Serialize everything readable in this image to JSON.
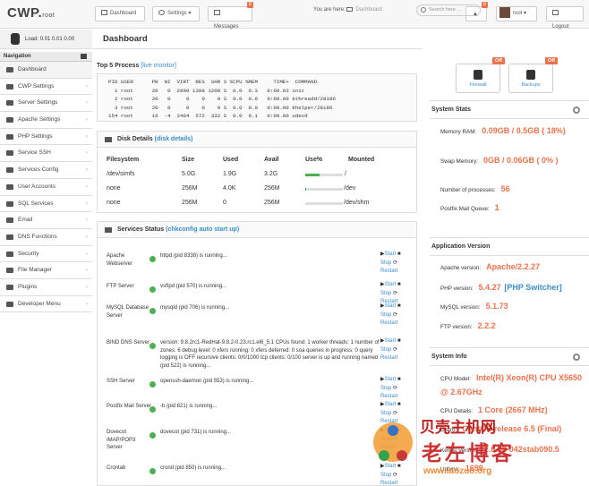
{
  "app": {
    "logo": "CWP.",
    "logo_sub": "root"
  },
  "topbar": {
    "dashboard": "Dashboard",
    "settings": "Settings",
    "messages": "Messages",
    "messages_badge": "8",
    "alerts_badge": "8",
    "user": "root",
    "logout": "Logout"
  },
  "load": {
    "label": "Load:",
    "values": "0.01  0.01  0.00"
  },
  "nav": {
    "header": "Navigation",
    "items": [
      {
        "label": "Dashboard",
        "caret": ""
      },
      {
        "label": "CWP Settings",
        "caret": "›"
      },
      {
        "label": "Server Settings",
        "caret": "›"
      },
      {
        "label": "Apache Settings",
        "caret": "›"
      },
      {
        "label": "PHP Settings",
        "caret": "›"
      },
      {
        "label": "Service SSH",
        "caret": "›"
      },
      {
        "label": "Services Config",
        "caret": "›"
      },
      {
        "label": "User Accounts",
        "caret": "›"
      },
      {
        "label": "SQL Services",
        "caret": "›"
      },
      {
        "label": "Email",
        "caret": "›"
      },
      {
        "label": "DNS Functions",
        "caret": "›"
      },
      {
        "label": "Security",
        "caret": "›"
      },
      {
        "label": "File Manager",
        "caret": "›"
      },
      {
        "label": "Plugins",
        "caret": "›"
      },
      {
        "label": "Developer Menu",
        "caret": "›"
      }
    ]
  },
  "page": {
    "title": "Dashboard",
    "breadcrumb_prefix": "You are here:",
    "breadcrumb": "Dashboard",
    "search_placeholder": "Search here ..."
  },
  "top5": {
    "title": "Top 5 Process",
    "link": "[live monitor]",
    "text": "PID USER      PR  NI  VIRT  RES  SHR S %CPU %MEM     TIME+  COMMAND\n  1 root      20   0  2900 1388 1208 S  0.0  0.3   0:00.03 init\n  2 root      20   0     0    0    0 S  0.0  0.0   0:00.00 kthreadd/28186\n  3 root      20   0     0    0    0 S  0.0  0.0   0:00.00 khelper/28186\n154 root      16  -4  2464  572  332 S  0.0  0.1   0:00.00 udevd"
  },
  "disk": {
    "title": "Disk Details",
    "link": "(disk details)",
    "headers": [
      "Filesystem",
      "Size",
      "Used",
      "Avail",
      "Use%",
      "Mounted"
    ],
    "rows": [
      {
        "fs": "/dev/simfs",
        "size": "5.0G",
        "used": "1.9G",
        "avail": "3.2G",
        "use": 0.38,
        "mount": "/"
      },
      {
        "fs": "none",
        "size": "256M",
        "used": "4.0K",
        "avail": "256M",
        "use": 0.01,
        "mount": "/dev"
      },
      {
        "fs": "none",
        "size": "256M",
        "used": "0",
        "avail": "256M",
        "use": 0.0,
        "mount": "/dev/shm"
      }
    ]
  },
  "services": {
    "title": "Services Status",
    "link": "(chkconfig auto start up)",
    "start": "Start",
    "stop": "Stop",
    "restart": "Restart",
    "rows": [
      {
        "name": "Apache Webserver",
        "status": "httpd (pid 8338) is running..."
      },
      {
        "name": "FTP Server",
        "status": "vsftpd (pid 570) is running..."
      },
      {
        "name": "MySQL Database Server",
        "status": "mysqld (pid 706) is running..."
      },
      {
        "name": "BIND DNS Server",
        "status": "version: 9.8.2rc1-RedHat-9.8.2-0.23.rc1.el6_5.1 CPUs found: 1 worker threads: 1 number of zones: 6 debug level: 0 xfers running: 0 xfers deferred: 0 soa queries in progress: 0 query logging is OFF recursive clients: 0/0/1000 tcp clients: 0/100 server is up and running named (pid 522) is running..."
      },
      {
        "name": "SSH Server",
        "status": "openssh-daemon (pid 553) is running..."
      },
      {
        "name": "Postfix Mail Server",
        "status": "-b (pid 821) is running..."
      },
      {
        "name": "Dovecot IMAP/POP3 Server",
        "status": "dovecot (pid 731) is running..."
      },
      {
        "name": "Crontab",
        "status": "crond (pid 850) is running..."
      }
    ]
  },
  "quick": {
    "firewall": "Firewall",
    "backups": "Backups",
    "off": "Off"
  },
  "stats": {
    "title": "System Stats",
    "ram_label": "Memory RAM:",
    "ram": "0.09GB / 0.5GB ( 18%)",
    "swap_label": "Swap Memory:",
    "swap": "0GB / 0.06GB ( 0% )",
    "proc_label": "Number of processes:",
    "proc": "56",
    "queue_label": "Postfix Mail Queue:",
    "queue": "1"
  },
  "appver": {
    "title": "Application Version",
    "apache_label": "Apache version:",
    "apache": "Apache/2.2.27",
    "php_label": "PHP version:",
    "php": "5.4.27",
    "php_switch": "[PHP Switcher]",
    "mysql_label": "MySQL version:",
    "mysql": "5.1.73",
    "ftp_label": "FTP version:",
    "ftp": "2.2.2"
  },
  "sysinfo": {
    "title": "System Info",
    "cpu_label": "CPU Model:",
    "cpu": "Intel(R) Xeon(R) CPU X5650 @ 2.67GHz",
    "cpud_label": "CPU Details:",
    "cpud": "1 Core (2667 MHz)",
    "distro_label": "Distro:",
    "distro": "CentOS release 6.5 (Final)",
    "kernel_label": "Kernel Version:",
    "kernel": "2.6.32-042stab090.5",
    "uptime_label": "Uptime:",
    "uptime": "1699"
  },
  "watermark": {
    "line1": "贝壳主机网",
    "line2": "老左博客",
    "url": "www.laozuo.org"
  },
  "colors": {
    "accent": "#e8734d",
    "link": "#3a8fc7",
    "ok": "#4caf50"
  }
}
